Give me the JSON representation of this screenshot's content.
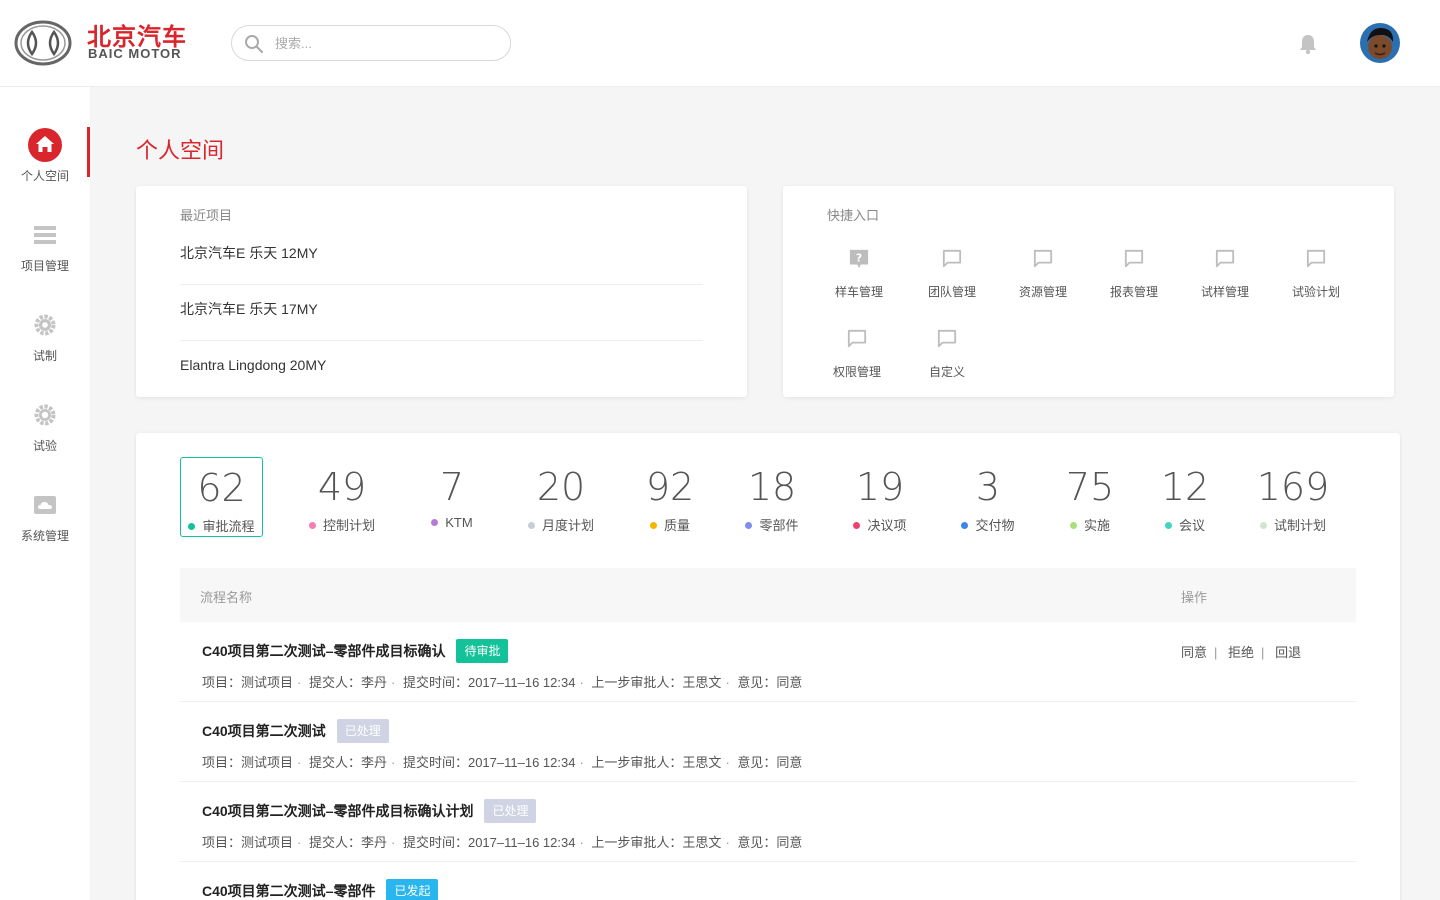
{
  "brand": {
    "name_cn": "北京汽车",
    "name_en": "BAIC MOTOR"
  },
  "search": {
    "placeholder": "搜索..."
  },
  "sidebar": {
    "items": [
      {
        "label": "个人空间",
        "icon": "home-icon",
        "active": true
      },
      {
        "label": "项目管理",
        "icon": "list-icon"
      },
      {
        "label": "试制",
        "icon": "gear-icon"
      },
      {
        "label": "试验",
        "icon": "cog-icon"
      },
      {
        "label": "系统管理",
        "icon": "cloud-icon"
      }
    ]
  },
  "page": {
    "title": "个人空间"
  },
  "recent": {
    "title": "最近项目",
    "items": [
      "北京汽车E 乐天 12MY",
      "北京汽车E 乐天 17MY",
      "Elantra Lingdong 20MY"
    ]
  },
  "quick": {
    "title": "快捷入口",
    "items": [
      {
        "label": "样车管理",
        "icon": "help-icon"
      },
      {
        "label": "团队管理",
        "icon": "chat-icon"
      },
      {
        "label": "资源管理",
        "icon": "chat-icon"
      },
      {
        "label": "报表管理",
        "icon": "chat-icon"
      },
      {
        "label": "试样管理",
        "icon": "chat-icon"
      },
      {
        "label": "试验计划",
        "icon": "chat-icon"
      },
      {
        "label": "权限管理",
        "icon": "chat-icon"
      },
      {
        "label": "自定义",
        "icon": "chat-icon"
      }
    ]
  },
  "stats": [
    {
      "value": "62",
      "label": "审批流程",
      "color": "#14c29a",
      "active": true
    },
    {
      "value": "49",
      "label": "控制计划",
      "color": "#f77eb3"
    },
    {
      "value": "7",
      "label": "KTM",
      "color": "#b57bd6"
    },
    {
      "value": "20",
      "label": "月度计划",
      "color": "#c9ccd9"
    },
    {
      "value": "92",
      "label": "质量",
      "color": "#f5b400"
    },
    {
      "value": "18",
      "label": "零部件",
      "color": "#7f8cf0"
    },
    {
      "value": "19",
      "label": "决议项",
      "color": "#f0406f"
    },
    {
      "value": "3",
      "label": "交付物",
      "color": "#3b86e8"
    },
    {
      "value": "75",
      "label": "实施",
      "color": "#a8e07a"
    },
    {
      "value": "12",
      "label": "会议",
      "color": "#3fd7c0"
    },
    {
      "value": "169",
      "label": "试制计划",
      "color": "#d2e4cf"
    }
  ],
  "table": {
    "col_name": "流程名称",
    "col_action": "操作",
    "rows": [
      {
        "title": "C40项目第二次测试–零部件成目标确认",
        "status": "待审批",
        "status_color": "#14c29a",
        "meta": {
          "project": "项目：测试项目",
          "submitter": "提交人：李丹",
          "time": "提交时间：2017–11–16 12:34",
          "prev": "上一步审批人：王思文",
          "opinion": "意见：同意"
        },
        "actions": [
          "同意",
          "拒绝",
          "回退"
        ]
      },
      {
        "title": "C40项目第二次测试",
        "status": "已处理",
        "status_color": "#cfd3e3",
        "meta": {
          "project": "项目：测试项目",
          "submitter": "提交人：李丹",
          "time": "提交时间：2017–11–16 12:34",
          "prev": "上一步审批人：王思文",
          "opinion": "意见：同意"
        }
      },
      {
        "title": "C40项目第二次测试–零部件成目标确认计划",
        "status": "已处理",
        "status_color": "#cfd3e3",
        "meta": {
          "project": "项目：测试项目",
          "submitter": "提交人：李丹",
          "time": "提交时间：2017–11–16 12:34",
          "prev": "上一步审批人：王思文",
          "opinion": "意见：同意"
        }
      },
      {
        "title": "C40项目第二次测试–零部件",
        "status": "已发起",
        "status_color": "#29b6ef"
      }
    ]
  }
}
